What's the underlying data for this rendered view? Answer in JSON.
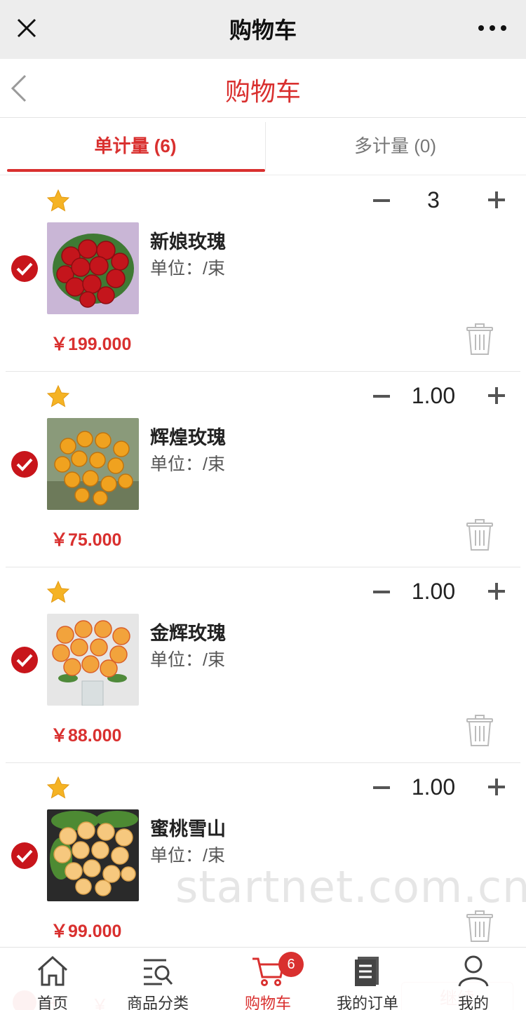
{
  "wechat_bar": {
    "title": "购物车"
  },
  "header": {
    "title": "购物车"
  },
  "tabs": [
    {
      "label": "单计量 (6)",
      "active": true
    },
    {
      "label": "多计量 (0)",
      "active": false
    }
  ],
  "items": [
    {
      "name": "新娘玫瑰",
      "unit": "单位：/束",
      "price": "￥199.000",
      "qty": "3",
      "checked": true
    },
    {
      "name": "辉煌玫瑰",
      "unit": "单位：/束",
      "price": "￥75.000",
      "qty": "1.00",
      "checked": true
    },
    {
      "name": "金辉玫瑰",
      "unit": "单位：/束",
      "price": "￥88.000",
      "qty": "1.00",
      "checked": true
    },
    {
      "name": "蜜桃雪山",
      "unit": "单位：/束",
      "price": "￥99.000",
      "qty": "1.00",
      "checked": true
    }
  ],
  "watermark": "startnet.com.cn",
  "summary": {
    "label": "计：",
    "price": "￥",
    "button": "继续"
  },
  "bottom_nav": [
    {
      "label": "首页",
      "icon": "home-icon"
    },
    {
      "label": "商品分类",
      "icon": "category-search-icon"
    },
    {
      "label": "购物车",
      "icon": "cart-icon",
      "badge": "6",
      "active": true
    },
    {
      "label": "我的订单",
      "icon": "order-list-icon"
    },
    {
      "label": "我的",
      "icon": "user-icon"
    }
  ],
  "colors": {
    "accent": "#d9302f",
    "star": "#f5b324",
    "bar": "#ededed"
  }
}
